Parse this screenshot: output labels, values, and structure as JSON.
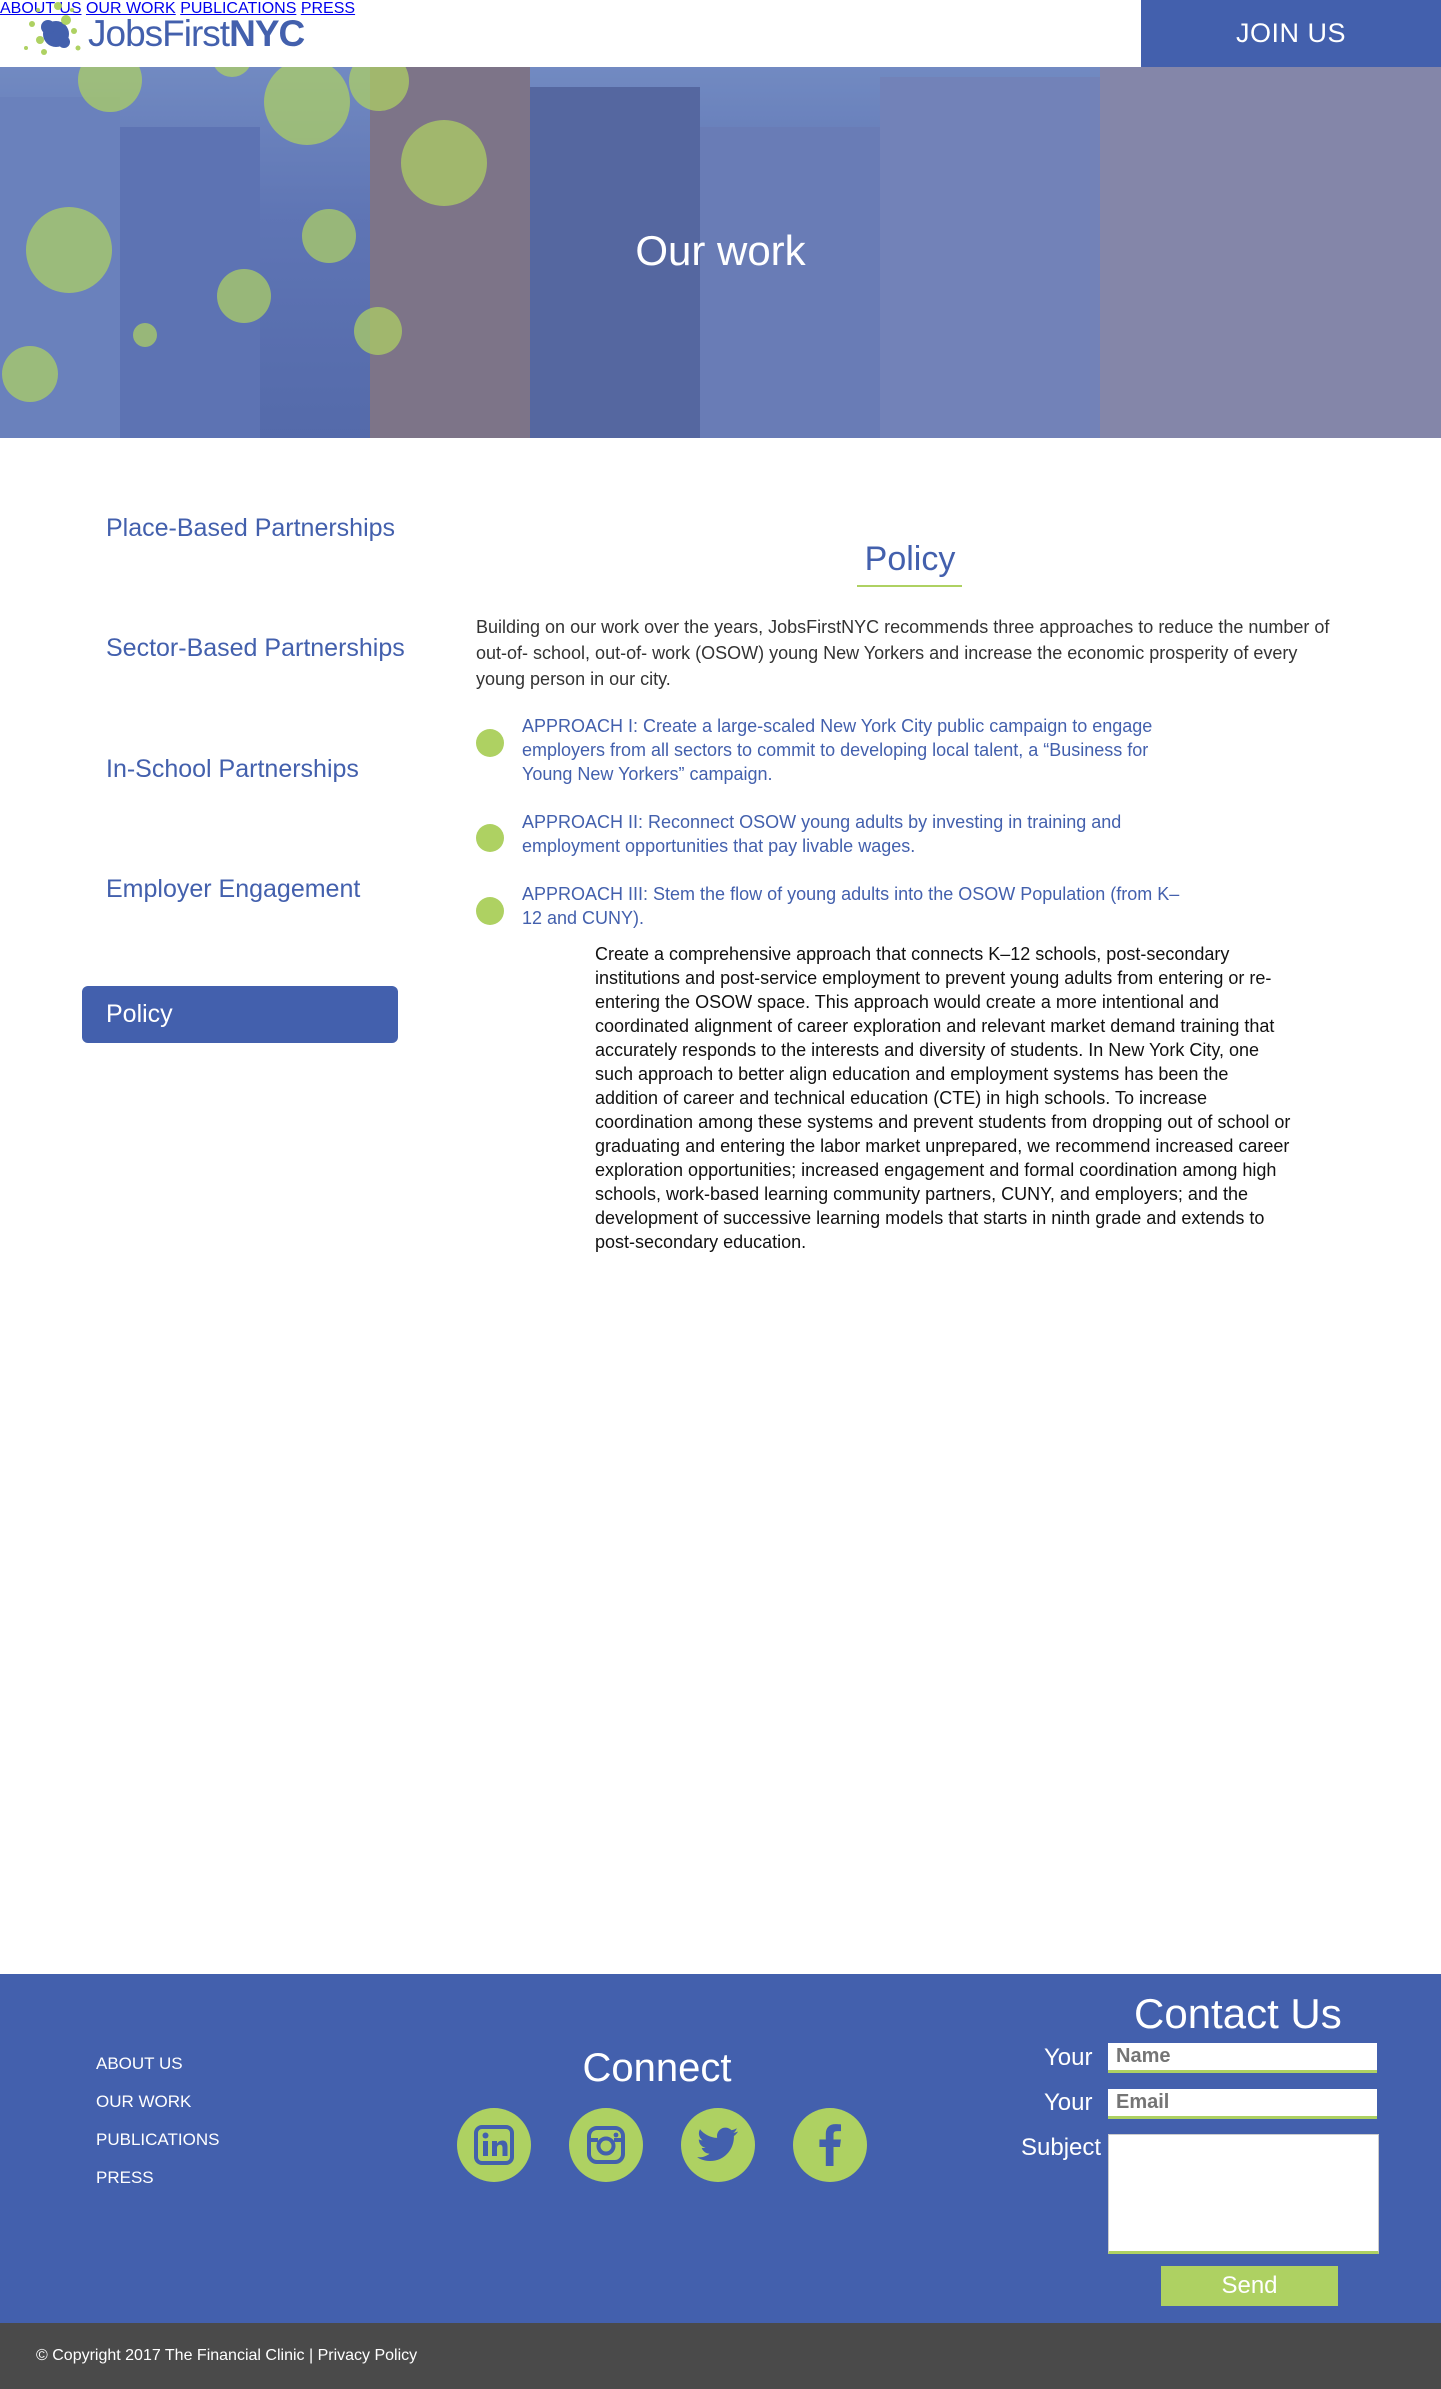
{
  "brand": {
    "logo_text_light": "Jobs",
    "logo_text_mid": "First",
    "logo_text_bold": "NYC",
    "primary_color": "#4360ad",
    "accent_color": "#aed162"
  },
  "nav": {
    "items": [
      "ABOUT US",
      "OUR WORK",
      "PUBLICATIONS",
      "PRESS"
    ],
    "cta": "JOIN US"
  },
  "hero": {
    "title": "Our work"
  },
  "sidebar": {
    "items": [
      "Place-Based Partnerships",
      "Sector-Based Partnerships",
      "In-School Partnerships",
      "Employer Engagement",
      "Policy"
    ],
    "active": "Policy"
  },
  "main": {
    "title": "Policy",
    "intro": "Building on our work over the years, JobsFirstNYC recommends three approaches to reduce the number of out-of- school, out-of- work (OSOW) young New Yorkers and increase the economic prosperity of every young person in our city.",
    "approaches": [
      "APPROACH I: Create a large-scaled New York City public campaign to engage employers from all sectors to commit to developing local talent, a “Business for Young New Yorkers” campaign.",
      "APPROACH II: Reconnect OSOW young adults by investing in training and employment opportunities that pay livable wages.",
      "APPROACH III: Stem the flow of young adults into the OSOW Population (from K–12 and CUNY)."
    ],
    "detail": "Create a comprehensive approach that connects K–12 schools, post-secondary institutions and post-service employment to prevent young adults from entering or re-entering the OSOW space. This approach would create a more intentional and coordinated alignment of career exploration and relevant market demand training that accurately responds to the interests and diversity of students. In New York City, one such approach to better align education and employment systems has been the addition of career and technical education (CTE) in high schools. To increase coordination among these systems and prevent students from dropping out of school or graduating and entering the labor market unprepared, we recommend increased career exploration opportunities; increased engagement and formal coordination among high schools, work-based learning community partners, CUNY, and employers; and the development of successive learning models that starts in ninth grade and extends to post-secondary education."
  },
  "footer": {
    "links": [
      "ABOUT US",
      "OUR WORK",
      "PUBLICATIONS",
      "PRESS"
    ],
    "connect_title": "Connect",
    "social": [
      "linkedin-icon",
      "instagram-icon",
      "twitter-icon",
      "facebook-icon"
    ],
    "contact": {
      "title": "Contact Us",
      "label_name": "Your",
      "label_email": "Your",
      "label_subject": "Subject",
      "placeholder_name": "Name",
      "placeholder_email": "Email",
      "send": "Send"
    },
    "copyright": "© Copyright 2017 The Financial Clinic | Privacy Policy"
  }
}
